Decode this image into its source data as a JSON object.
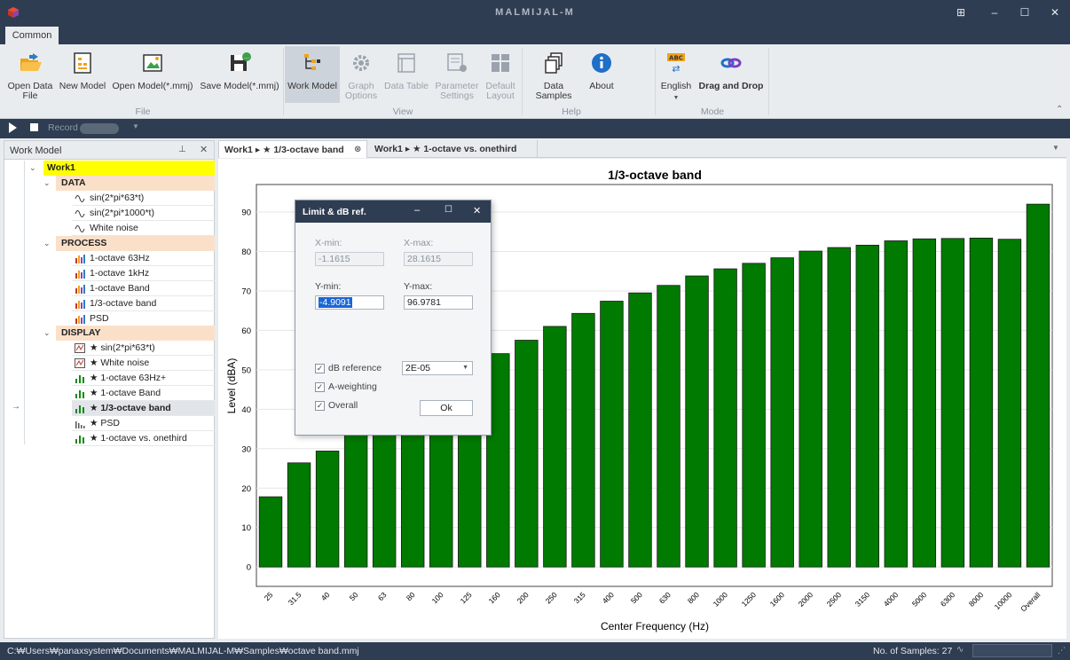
{
  "window": {
    "title": "MALMIJAL-M",
    "controls": [
      "⊞",
      "–",
      "☐",
      "✕"
    ]
  },
  "ribbon": {
    "tab": "Common",
    "groups": {
      "file": "File",
      "view": "View",
      "help": "Help",
      "mode": "Mode"
    },
    "buttons": {
      "open_data_file": "Open Data File",
      "new_model": "New Model",
      "open_model": "Open Model(*.mmj)",
      "save_model": "Save Model(*.mmj)",
      "work_model": "Work Model",
      "graph_options": "Graph Options",
      "data_table": "Data Table",
      "parameter_settings": "Parameter Settings",
      "default_layout": "Default Layout",
      "data_samples": "Data Samples",
      "about": "About",
      "english": "English",
      "drag_and_drop": "Drag and Drop"
    },
    "english_icon_text": "ABC"
  },
  "record_bar": {
    "record_label": "Record"
  },
  "work_model_panel": {
    "title": "Work Model",
    "root": "Work1",
    "sections": {
      "data": {
        "label": "DATA",
        "items": [
          "sin(2*pi*63*t)",
          "sin(2*pi*1000*t)",
          "White noise"
        ]
      },
      "process": {
        "label": "PROCESS",
        "items": [
          "1-octave 63Hz",
          "1-octave 1kHz",
          "1-octave Band",
          "1/3-octave band",
          "PSD"
        ]
      },
      "display": {
        "label": "DISPLAY",
        "items": [
          "★ sin(2*pi*63*t)",
          "★ White noise",
          "★ 1-octave 63Hz+",
          "★ 1-octave Band",
          "★ 1/3-octave band",
          "★ PSD",
          "★ 1-octave vs. onethird"
        ]
      }
    }
  },
  "doc_tabs": [
    "Work1 ▸ ★ 1/3-octave band",
    "Work1 ▸ ★ 1-octave vs. onethird"
  ],
  "chart_data": {
    "type": "bar",
    "title": "1/3-octave band",
    "xlabel": "Center Frequency (Hz)",
    "ylabel": "Level (dBA)",
    "ylim": [
      -4.9091,
      96.9781
    ],
    "yticks": [
      0,
      10,
      20,
      30,
      40,
      50,
      60,
      70,
      80,
      90
    ],
    "categories": [
      "25",
      "31.5",
      "40",
      "50",
      "63",
      "80",
      "100",
      "125",
      "160",
      "200",
      "250",
      "315",
      "400",
      "500",
      "630",
      "800",
      "1000",
      "1250",
      "1600",
      "2000",
      "2500",
      "3150",
      "4000",
      "5000",
      "6300",
      "8000",
      "10000",
      "Overall"
    ],
    "values": [
      17.8,
      26.4,
      29.4,
      34.5,
      38.5,
      40.6,
      45.5,
      50.2,
      54.1,
      57.5,
      61.0,
      64.3,
      67.4,
      69.5,
      71.4,
      73.8,
      75.6,
      77.0,
      78.4,
      80.1,
      81.0,
      81.6,
      82.7,
      83.2,
      83.3,
      83.4,
      83.1,
      92.0
    ],
    "bar_color": "#007a00",
    "grid": true,
    "legend": "none"
  },
  "dialog": {
    "title": "Limit & dB ref.",
    "x_min_label": "X-min:",
    "x_max_label": "X-max:",
    "x_min": "-1.1615",
    "x_max": "28.1615",
    "y_min_label": "Y-min:",
    "y_max_label": "Y-max:",
    "y_min": "-4.9091",
    "y_max": "96.9781",
    "db_reference_label": "dB reference",
    "db_reference_value": "2E-05",
    "a_weighting_label": "A-weighting",
    "overall_label": "Overall",
    "ok_label": "Ok"
  },
  "status_bar": {
    "path": "C:₩Users₩panaxsystem₩Documents₩MALMIJAL-M₩Samples₩octave band.mmj",
    "samples": "No. of Samples: 27"
  }
}
